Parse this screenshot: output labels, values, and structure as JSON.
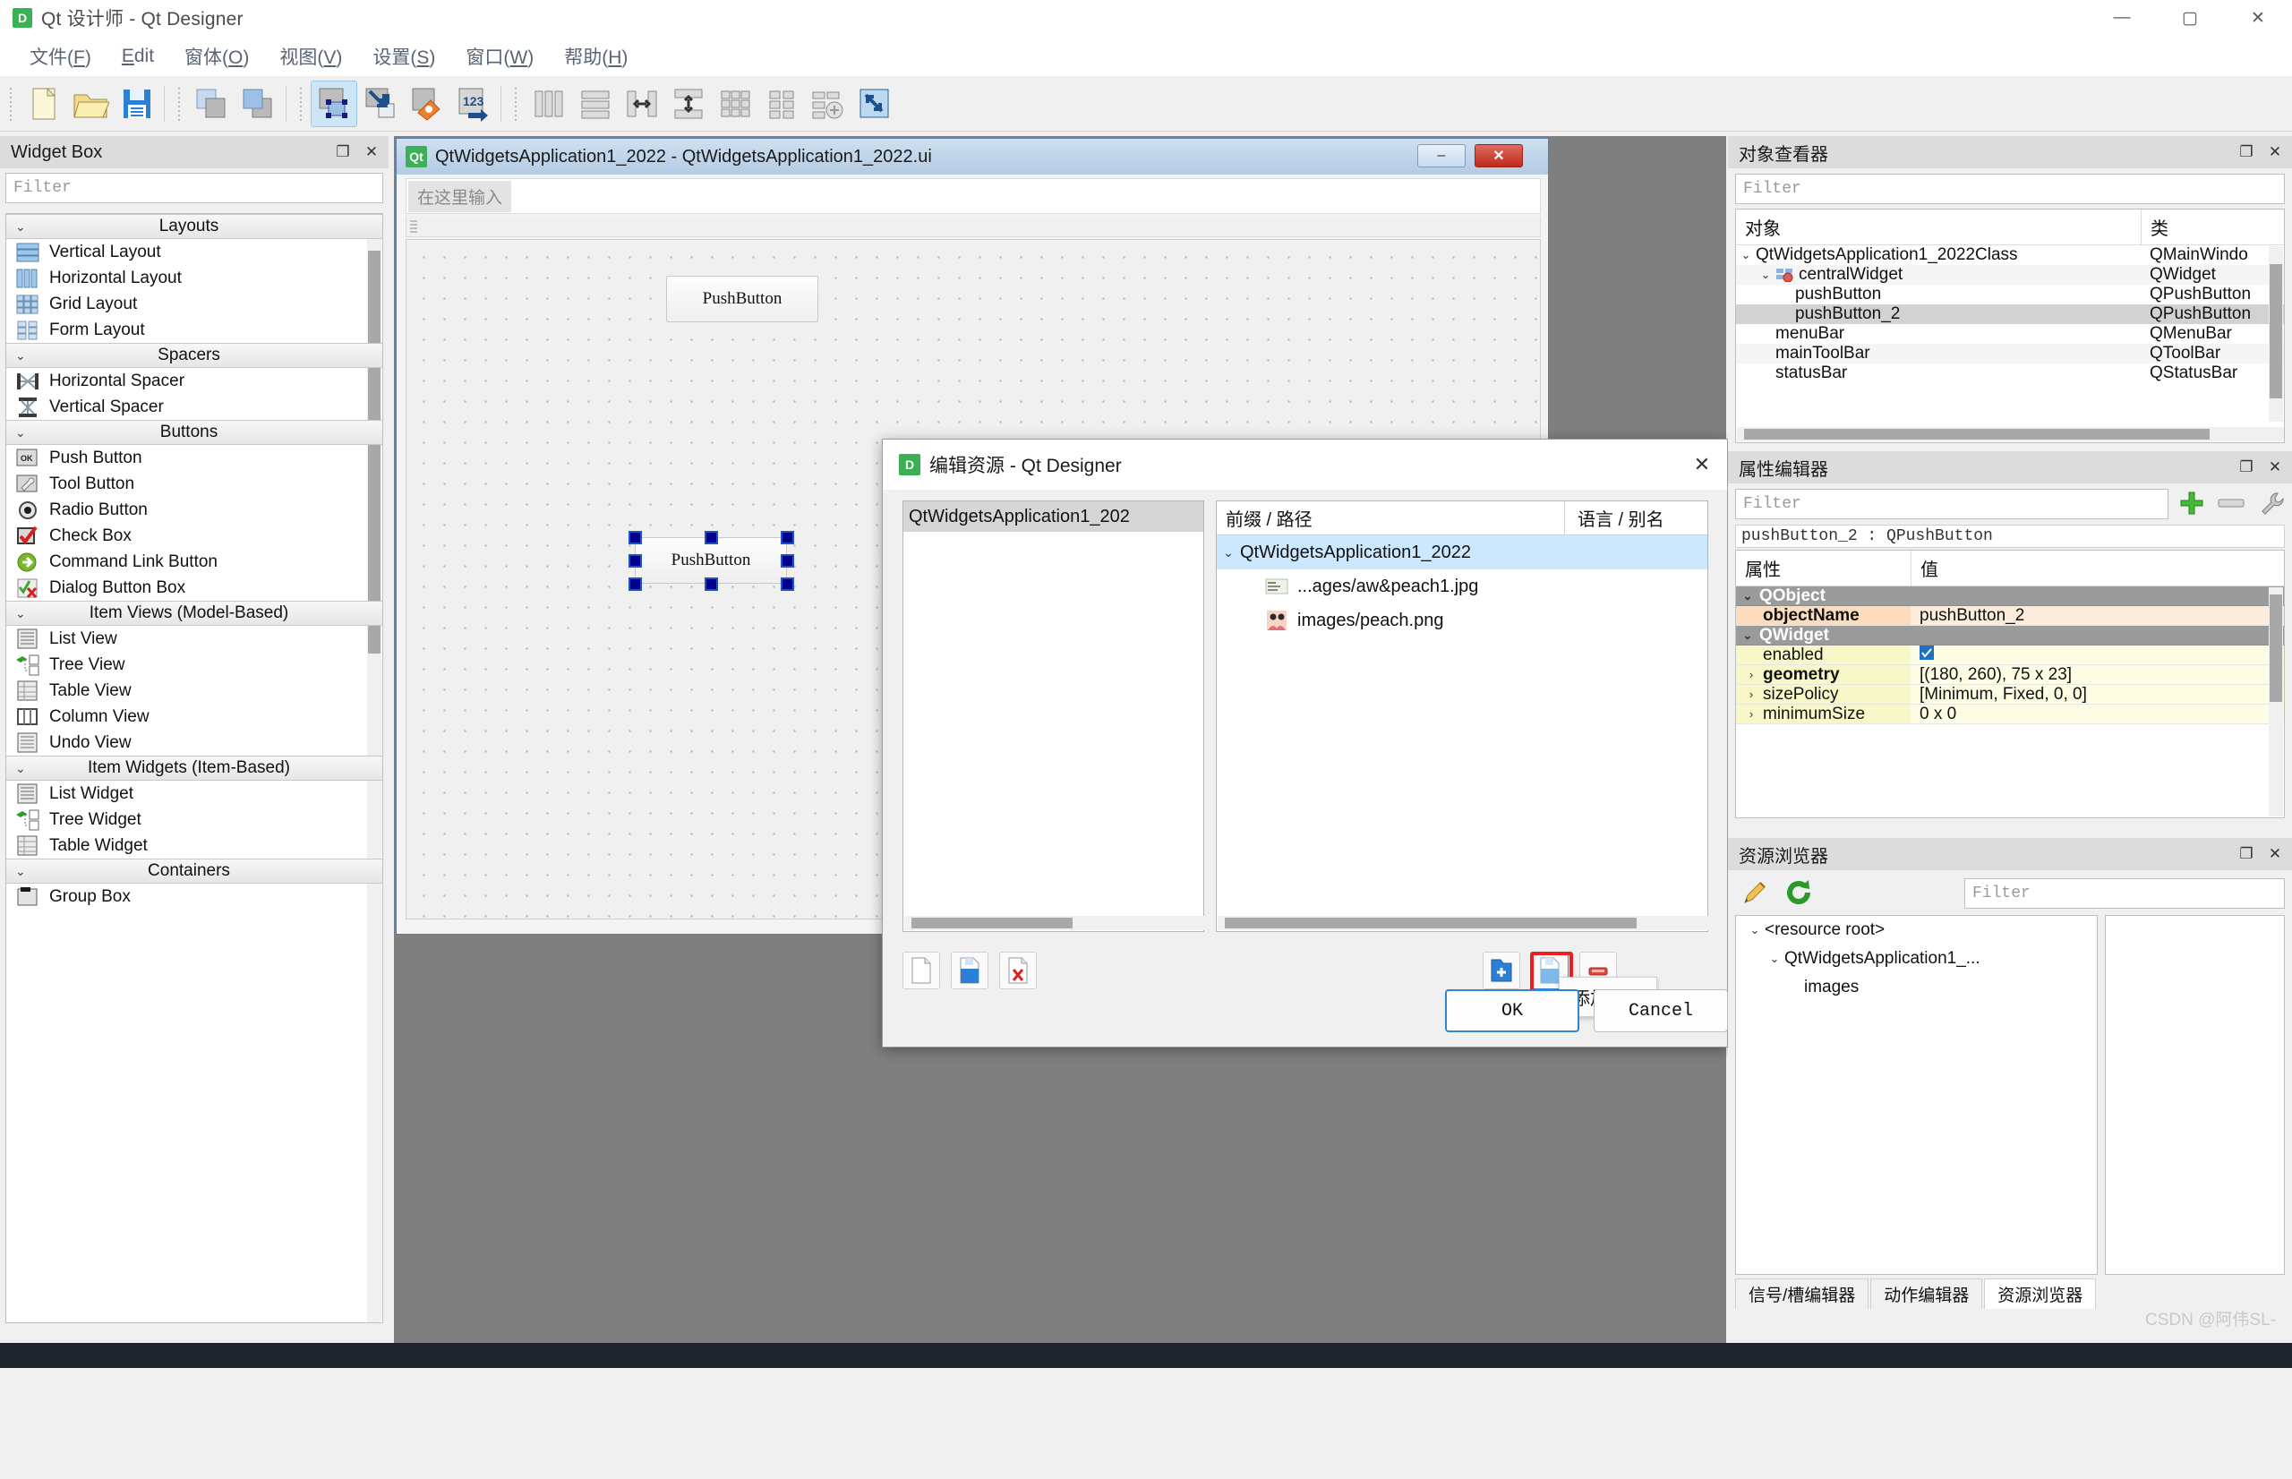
{
  "window": {
    "title": "Qt 设计师 - Qt Designer",
    "icon": "D",
    "minimize": "—",
    "maximize": "▢",
    "close": "✕"
  },
  "menubar": {
    "items": [
      {
        "label": "文件(F)"
      },
      {
        "label": "Edit"
      },
      {
        "label": "窗体(O)"
      },
      {
        "label": "视图(V)"
      },
      {
        "label": "设置(S)"
      },
      {
        "label": "窗口(W)"
      },
      {
        "label": "帮助(H)"
      }
    ]
  },
  "toolbar": {
    "buttons": [
      {
        "name": "new-form-icon"
      },
      {
        "name": "open-form-icon"
      },
      {
        "name": "save-form-icon"
      },
      {
        "name": "edit-widgets-icon"
      },
      {
        "name": "edit-signals-slots-icon"
      },
      {
        "name": "edit-buddies-icon"
      },
      {
        "name": "edit-tab-order-icon"
      },
      {
        "name": "layout-horizontally-icon"
      },
      {
        "name": "layout-vertically-icon"
      },
      {
        "name": "layout-in-splitter-horizontal-icon"
      },
      {
        "name": "layout-in-splitter-vertical-icon"
      },
      {
        "name": "layout-in-grid-icon"
      },
      {
        "name": "layout-in-form-icon"
      },
      {
        "name": "break-layout-icon"
      },
      {
        "name": "adjust-size-icon"
      }
    ]
  },
  "widget_box": {
    "title": "Widget Box",
    "filter_placeholder": "Filter",
    "float_icon": "❐",
    "close_icon": "✕",
    "categories": [
      {
        "name": "Layouts",
        "items": [
          {
            "label": "Vertical Layout",
            "icon": "vertical-layout-icon"
          },
          {
            "label": "Horizontal Layout",
            "icon": "horizontal-layout-icon"
          },
          {
            "label": "Grid Layout",
            "icon": "grid-layout-icon"
          },
          {
            "label": "Form Layout",
            "icon": "form-layout-icon"
          }
        ]
      },
      {
        "name": "Spacers",
        "items": [
          {
            "label": "Horizontal Spacer",
            "icon": "horizontal-spacer-icon"
          },
          {
            "label": "Vertical Spacer",
            "icon": "vertical-spacer-icon"
          }
        ]
      },
      {
        "name": "Buttons",
        "items": [
          {
            "label": "Push Button",
            "icon": "push-button-icon"
          },
          {
            "label": "Tool Button",
            "icon": "tool-button-icon"
          },
          {
            "label": "Radio Button",
            "icon": "radio-button-icon"
          },
          {
            "label": "Check Box",
            "icon": "check-box-icon"
          },
          {
            "label": "Command Link Button",
            "icon": "command-link-button-icon"
          },
          {
            "label": "Dialog Button Box",
            "icon": "dialog-button-box-icon"
          }
        ]
      },
      {
        "name": "Item Views (Model-Based)",
        "items": [
          {
            "label": "List View",
            "icon": "list-view-icon"
          },
          {
            "label": "Tree View",
            "icon": "tree-view-icon"
          },
          {
            "label": "Table View",
            "icon": "table-view-icon"
          },
          {
            "label": "Column View",
            "icon": "column-view-icon"
          },
          {
            "label": "Undo View",
            "icon": "undo-view-icon"
          }
        ]
      },
      {
        "name": "Item Widgets (Item-Based)",
        "items": [
          {
            "label": "List Widget",
            "icon": "list-widget-icon"
          },
          {
            "label": "Tree Widget",
            "icon": "tree-widget-icon"
          },
          {
            "label": "Table Widget",
            "icon": "table-widget-icon"
          }
        ]
      },
      {
        "name": "Containers",
        "items": [
          {
            "label": "Group Box",
            "icon": "group-box-icon"
          }
        ]
      }
    ]
  },
  "form_window": {
    "title": "QtWidgetsApplication1_2022 - QtWidgetsApplication1_2022.ui",
    "icon": "Qt",
    "minimize": "–",
    "close": "✕",
    "menubar_placeholder": "在这里输入",
    "widgets": [
      {
        "label": "PushButton",
        "name": "pushButton",
        "selected": false
      },
      {
        "label": "PushButton",
        "name": "pushButton_2",
        "selected": true
      }
    ]
  },
  "dialog": {
    "title": "编辑资源 - Qt Designer",
    "icon": "D",
    "close": "✕",
    "left_panel": {
      "selected_item": "QtWidgetsApplication1_202"
    },
    "right_panel": {
      "col_prefix_path": "前缀 / 路径",
      "col_language_alias": "语言 / 别名",
      "rows": [
        {
          "label": "QtWidgetsApplication1_2022",
          "level": 0,
          "selected": true,
          "icon": "folder-icon"
        },
        {
          "label": "...ages/aw&peach1.jpg",
          "level": 1,
          "selected": false,
          "icon": "image-icon"
        },
        {
          "label": "images/peach.png",
          "level": 1,
          "selected": false,
          "icon": "image-icon"
        }
      ]
    },
    "left_toolbar": [
      {
        "name": "new-resource-file-icon"
      },
      {
        "name": "open-resource-file-icon"
      },
      {
        "name": "remove-resource-file-icon"
      }
    ],
    "right_toolbar": [
      {
        "name": "add-prefix-icon"
      },
      {
        "name": "add-file-icon"
      },
      {
        "name": "remove-item-icon"
      }
    ],
    "tooltip": "添加文件",
    "ok_label": "OK",
    "cancel_label": "Cancel"
  },
  "object_inspector": {
    "title": "对象查看器",
    "filter_placeholder": "Filter",
    "float_icon": "❐",
    "close_icon": "✕",
    "col_object": "对象",
    "col_class": "类",
    "rows": [
      {
        "name": "QtWidgetsApplication1_2022Class",
        "cls": "QMainWindo",
        "level": 0,
        "expander": "⌄",
        "selected": false
      },
      {
        "name": "centralWidget",
        "cls": "QWidget",
        "level": 1,
        "expander": "⌄",
        "selected": false,
        "icon": "widget-icon"
      },
      {
        "name": "pushButton",
        "cls": "QPushButton",
        "level": 2,
        "expander": "",
        "selected": false
      },
      {
        "name": "pushButton_2",
        "cls": "QPushButton",
        "level": 2,
        "expander": "",
        "selected": true
      },
      {
        "name": "menuBar",
        "cls": "QMenuBar",
        "level": 1,
        "expander": "",
        "selected": false
      },
      {
        "name": "mainToolBar",
        "cls": "QToolBar",
        "level": 1,
        "expander": "",
        "selected": false
      },
      {
        "name": "statusBar",
        "cls": "QStatusBar",
        "level": 1,
        "expander": "",
        "selected": false
      }
    ]
  },
  "property_editor": {
    "title": "属性编辑器",
    "filter_placeholder": "Filter",
    "float_icon": "❐",
    "close_icon": "✕",
    "add_icon": "add-property-icon",
    "remove_icon": "remove-property-icon",
    "configure_icon": "configure-icon",
    "object_line": "pushButton_2 : QPushButton",
    "col_property": "属性",
    "col_value": "值",
    "rows": [
      {
        "kind": "group",
        "name": "QObject",
        "value": "",
        "expander": "⌄"
      },
      {
        "kind": "object",
        "name": "objectName",
        "value": "pushButton_2",
        "expander": "",
        "bold": true
      },
      {
        "kind": "group",
        "name": "QWidget",
        "value": "",
        "expander": "⌄"
      },
      {
        "kind": "widget",
        "name": "enabled",
        "value": "",
        "expander": "",
        "checkbox": true
      },
      {
        "kind": "widget",
        "name": "geometry",
        "value": "[(180, 260), 75 x 23]",
        "expander": "›",
        "bold": true
      },
      {
        "kind": "widget",
        "name": "sizePolicy",
        "value": "[Minimum, Fixed, 0, 0]",
        "expander": "›"
      },
      {
        "kind": "widget",
        "name": "minimumSize",
        "value": "0 x 0",
        "expander": "›"
      }
    ]
  },
  "resource_browser": {
    "title": "资源浏览器",
    "float_icon": "❐",
    "close_icon": "✕",
    "edit_icon": "edit-resources-icon",
    "reload_icon": "reload-icon",
    "filter_placeholder": "Filter",
    "tree": [
      {
        "label": "<resource root>",
        "level": 0,
        "expander": "⌄"
      },
      {
        "label": "QtWidgetsApplication1_...",
        "level": 1,
        "expander": "⌄"
      },
      {
        "label": "images",
        "level": 2,
        "expander": ""
      }
    ]
  },
  "bottom_tabs": {
    "tabs": [
      {
        "label": "信号/槽编辑器",
        "active": false
      },
      {
        "label": "动作编辑器",
        "active": false
      },
      {
        "label": "资源浏览器",
        "active": true
      }
    ]
  },
  "watermark": "CSDN @阿伟SL-"
}
